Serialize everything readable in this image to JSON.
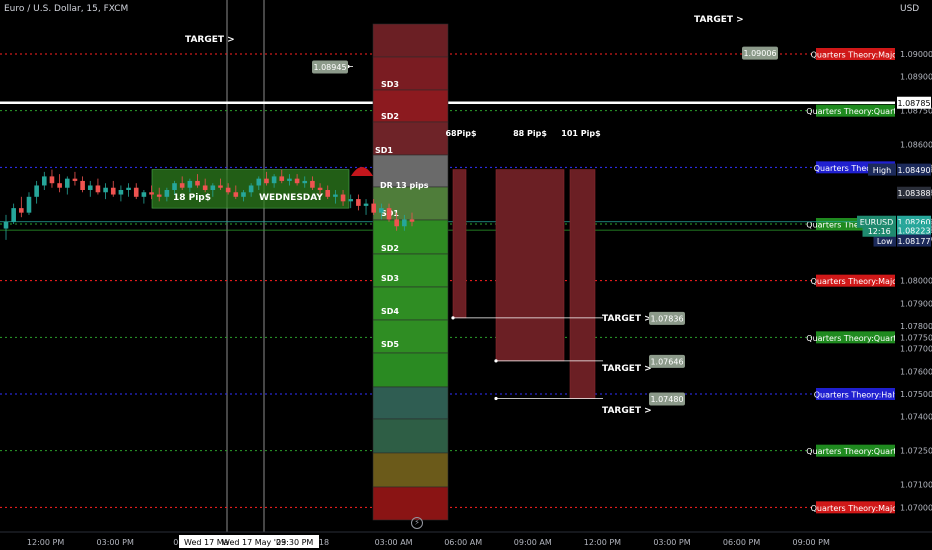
{
  "header": {
    "title": "Euro / U.S. Dollar, 15, FXCM",
    "currency": "USD"
  },
  "icons": {
    "bolt": "lightning-icon"
  },
  "colors": {
    "background": "#000000",
    "major": "#ff2020",
    "quarter": "#2ba02b",
    "half": "#3030ff",
    "white": "#ffffff",
    "bull": "#26a69a",
    "bear": "#ef5350",
    "target_box": "#8c9a8a"
  },
  "chart_data": {
    "type": "candlestick",
    "y_axis": {
      "range": [
        1.069,
        1.0915
      ],
      "ticks": [
        "1.09000",
        "1.08900",
        "1.08750",
        "1.08600",
        "1.08500",
        "1.08490",
        "1.08388",
        "1.08260",
        "1.08250",
        "1.08223",
        "1.08177",
        "1.08000",
        "1.07900",
        "1.07800",
        "1.07750",
        "1.07700",
        "1.07600",
        "1.07500",
        "1.07400",
        "1.07250",
        "1.07100",
        "1.07000"
      ]
    },
    "x_axis": {
      "ticks": [
        {
          "label": "12:00 PM",
          "hours": -12
        },
        {
          "label": "03:00 PM",
          "hours": -9
        },
        {
          "label": "06:00",
          "hours": -6
        },
        {
          "label": "18",
          "hours": 0
        },
        {
          "label": "03:00 AM",
          "hours": 3
        },
        {
          "label": "06:00 AM",
          "hours": 6
        },
        {
          "label": "09:00 AM",
          "hours": 9
        },
        {
          "label": "12:00 PM",
          "hours": 12
        },
        {
          "label": "03:00 PM",
          "hours": 15
        },
        {
          "label": "06:00 PM",
          "hours": 18
        },
        {
          "label": "09:00 PM",
          "hours": 21
        }
      ],
      "cursor_labels": [
        "Wed 17 Ma",
        "Wed 17 May '23",
        "09:30 PM"
      ]
    },
    "price_labels": [
      {
        "value": 1.08785,
        "text": "1.08785",
        "style": "white"
      },
      {
        "value": 1.08388,
        "text": "1.08388",
        "style": "dark"
      },
      {
        "value": 1.0826,
        "text": "1.08260",
        "style": "green"
      },
      {
        "value": 1.08223,
        "text": "1.08223",
        "style": "green"
      },
      {
        "value": 1.0849,
        "text": "1.08490",
        "style": "navy"
      },
      {
        "value": 1.08177,
        "text": "1.08177",
        "style": "navy"
      }
    ],
    "side_labels": [
      {
        "value": 1.0849,
        "text": "High"
      },
      {
        "value": 1.08177,
        "text": "Low"
      },
      {
        "value": 1.0826,
        "text": "EURUSD"
      },
      {
        "value": 1.0826,
        "text": "12:16",
        "offset": 9
      }
    ],
    "levels": [
      {
        "value": 1.09,
        "label": "Quarters Theory:Major",
        "type": "major"
      },
      {
        "value": 1.0875,
        "label": "Quarters Theory:Quarter",
        "type": "quarter"
      },
      {
        "value": 1.085,
        "label": "Quarters Theory:Half",
        "type": "half"
      },
      {
        "value": 1.0825,
        "label": "Quarters Theory:Quarter",
        "type": "quarter"
      },
      {
        "value": 1.08,
        "label": "Quarters Theory:Major",
        "type": "major"
      },
      {
        "value": 1.0775,
        "label": "Quarters Theory:Quarter",
        "type": "quarter"
      },
      {
        "value": 1.075,
        "label": "Quarters Theory:Half",
        "type": "half"
      },
      {
        "value": 1.0725,
        "label": "Quarters Theory:Quarter",
        "type": "quarter"
      },
      {
        "value": 1.07,
        "label": "Quarters Theory:Major",
        "type": "major"
      }
    ],
    "white_line": 1.08785,
    "sd_zones": {
      "labels_up": [
        "SD3",
        "SD2",
        "SD1"
      ],
      "dr_label": "DR 13 pips",
      "labels_down": [
        "SD1",
        "SD2",
        "SD3",
        "SD4",
        "SD5"
      ]
    },
    "range_box": {
      "pips_label": "18 Pip$",
      "day_label": "WEDNESDAY",
      "high": 1.0849,
      "low": 1.0832
    },
    "pip_boxes": [
      {
        "label": "68Pip$",
        "top": 1.0849,
        "bottom": 1.07836
      },
      {
        "label": "88 Pip$",
        "top": 1.0849,
        "bottom": 1.07646
      },
      {
        "label": "101 Pip$",
        "top": 1.0849,
        "bottom": 1.0748
      }
    ],
    "targets": [
      {
        "label": "TARGET >",
        "value": 1.09006,
        "text": "1.09006"
      },
      {
        "label": "TARGET >",
        "value": 1.08945,
        "text": "1.08945"
      },
      {
        "label": "TARGET >",
        "value": 1.07836,
        "text": "1.07836"
      },
      {
        "label": "TARGET >",
        "value": 1.07646,
        "text": "1.07646"
      },
      {
        "label": "TARGET >",
        "value": 1.0748,
        "text": "1.07480"
      }
    ],
    "candles": [
      [
        1.0823,
        1.0829,
        1.0818,
        1.0826
      ],
      [
        1.0826,
        1.0834,
        1.0825,
        1.0832
      ],
      [
        1.0832,
        1.0837,
        1.0828,
        1.083
      ],
      [
        1.083,
        1.0839,
        1.0829,
        1.0837
      ],
      [
        1.0837,
        1.0844,
        1.0834,
        1.0842
      ],
      [
        1.0842,
        1.0848,
        1.084,
        1.0846
      ],
      [
        1.0846,
        1.0849,
        1.0841,
        1.0843
      ],
      [
        1.0843,
        1.0847,
        1.0839,
        1.0841
      ],
      [
        1.0841,
        1.0846,
        1.0838,
        1.0845
      ],
      [
        1.0845,
        1.0848,
        1.0842,
        1.0844
      ],
      [
        1.0844,
        1.0846,
        1.0839,
        1.084
      ],
      [
        1.084,
        1.0844,
        1.0837,
        1.0842
      ],
      [
        1.0842,
        1.0845,
        1.0838,
        1.0839
      ],
      [
        1.0839,
        1.0843,
        1.0836,
        1.0841
      ],
      [
        1.0841,
        1.0844,
        1.0837,
        1.0838
      ],
      [
        1.0838,
        1.0842,
        1.0835,
        1.084
      ],
      [
        1.084,
        1.0843,
        1.0837,
        1.0841
      ],
      [
        1.0841,
        1.0843,
        1.0836,
        1.0837
      ],
      [
        1.0837,
        1.084,
        1.0834,
        1.0839
      ],
      [
        1.0839,
        1.0842,
        1.0836,
        1.0838
      ],
      [
        1.0838,
        1.0841,
        1.0835,
        1.0837
      ],
      [
        1.0837,
        1.0841,
        1.0835,
        1.084
      ],
      [
        1.084,
        1.0844,
        1.0838,
        1.0843
      ],
      [
        1.0843,
        1.0846,
        1.084,
        1.0841
      ],
      [
        1.0841,
        1.0845,
        1.0839,
        1.0844
      ],
      [
        1.0844,
        1.0847,
        1.0841,
        1.0842
      ],
      [
        1.0842,
        1.0845,
        1.0839,
        1.084
      ],
      [
        1.084,
        1.0843,
        1.0837,
        1.0842
      ],
      [
        1.0842,
        1.0845,
        1.084,
        1.0841
      ],
      [
        1.0841,
        1.0843,
        1.0838,
        1.0839
      ],
      [
        1.0839,
        1.0842,
        1.0836,
        1.0837
      ],
      [
        1.0837,
        1.084,
        1.0835,
        1.0839
      ],
      [
        1.0839,
        1.0843,
        1.0837,
        1.0842
      ],
      [
        1.0842,
        1.0846,
        1.084,
        1.0845
      ],
      [
        1.0845,
        1.0848,
        1.0842,
        1.0843
      ],
      [
        1.0843,
        1.0847,
        1.0841,
        1.0846
      ],
      [
        1.0846,
        1.0849,
        1.0843,
        1.0844
      ],
      [
        1.0844,
        1.0847,
        1.0842,
        1.0845
      ],
      [
        1.0845,
        1.0847,
        1.0842,
        1.0843
      ],
      [
        1.0843,
        1.0846,
        1.0841,
        1.0844
      ],
      [
        1.0844,
        1.0846,
        1.084,
        1.0841
      ],
      [
        1.0841,
        1.0843,
        1.0838,
        1.084
      ],
      [
        1.084,
        1.0842,
        1.0836,
        1.0837
      ],
      [
        1.0837,
        1.084,
        1.0834,
        1.0838
      ],
      [
        1.0838,
        1.084,
        1.0833,
        1.0835
      ],
      [
        1.0835,
        1.0838,
        1.0832,
        1.0836
      ],
      [
        1.0836,
        1.0838,
        1.0831,
        1.0833
      ],
      [
        1.0833,
        1.0836,
        1.0829,
        1.0834
      ],
      [
        1.0834,
        1.0836,
        1.0829,
        1.083
      ],
      [
        1.083,
        1.0834,
        1.0827,
        1.0832
      ],
      [
        1.0832,
        1.0834,
        1.0826,
        1.0827
      ],
      [
        1.0827,
        1.083,
        1.0822,
        1.0824
      ],
      [
        1.0824,
        1.0829,
        1.0822,
        1.0827
      ],
      [
        1.0827,
        1.083,
        1.0824,
        1.0826
      ]
    ]
  }
}
